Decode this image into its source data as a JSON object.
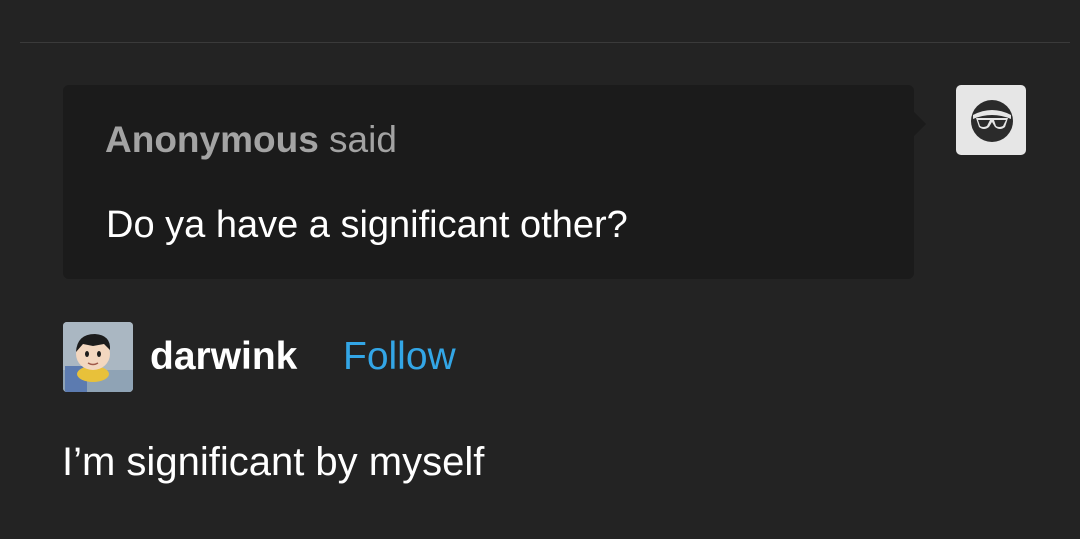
{
  "ask": {
    "asker_name": "Anonymous",
    "said_label": " said",
    "question": "Do ya have a significant other?"
  },
  "anonymous_avatar": {
    "icon": "sunglasses-face-icon",
    "background": "#e6e6e6"
  },
  "answer": {
    "username": "darwink",
    "follow_label": "Follow",
    "reply_text": "I’m significant by myself"
  },
  "colors": {
    "background": "#232323",
    "ask_box": "#1b1b1b",
    "asker_text": "#a3a3a3",
    "follow_link": "#33a6e6"
  }
}
